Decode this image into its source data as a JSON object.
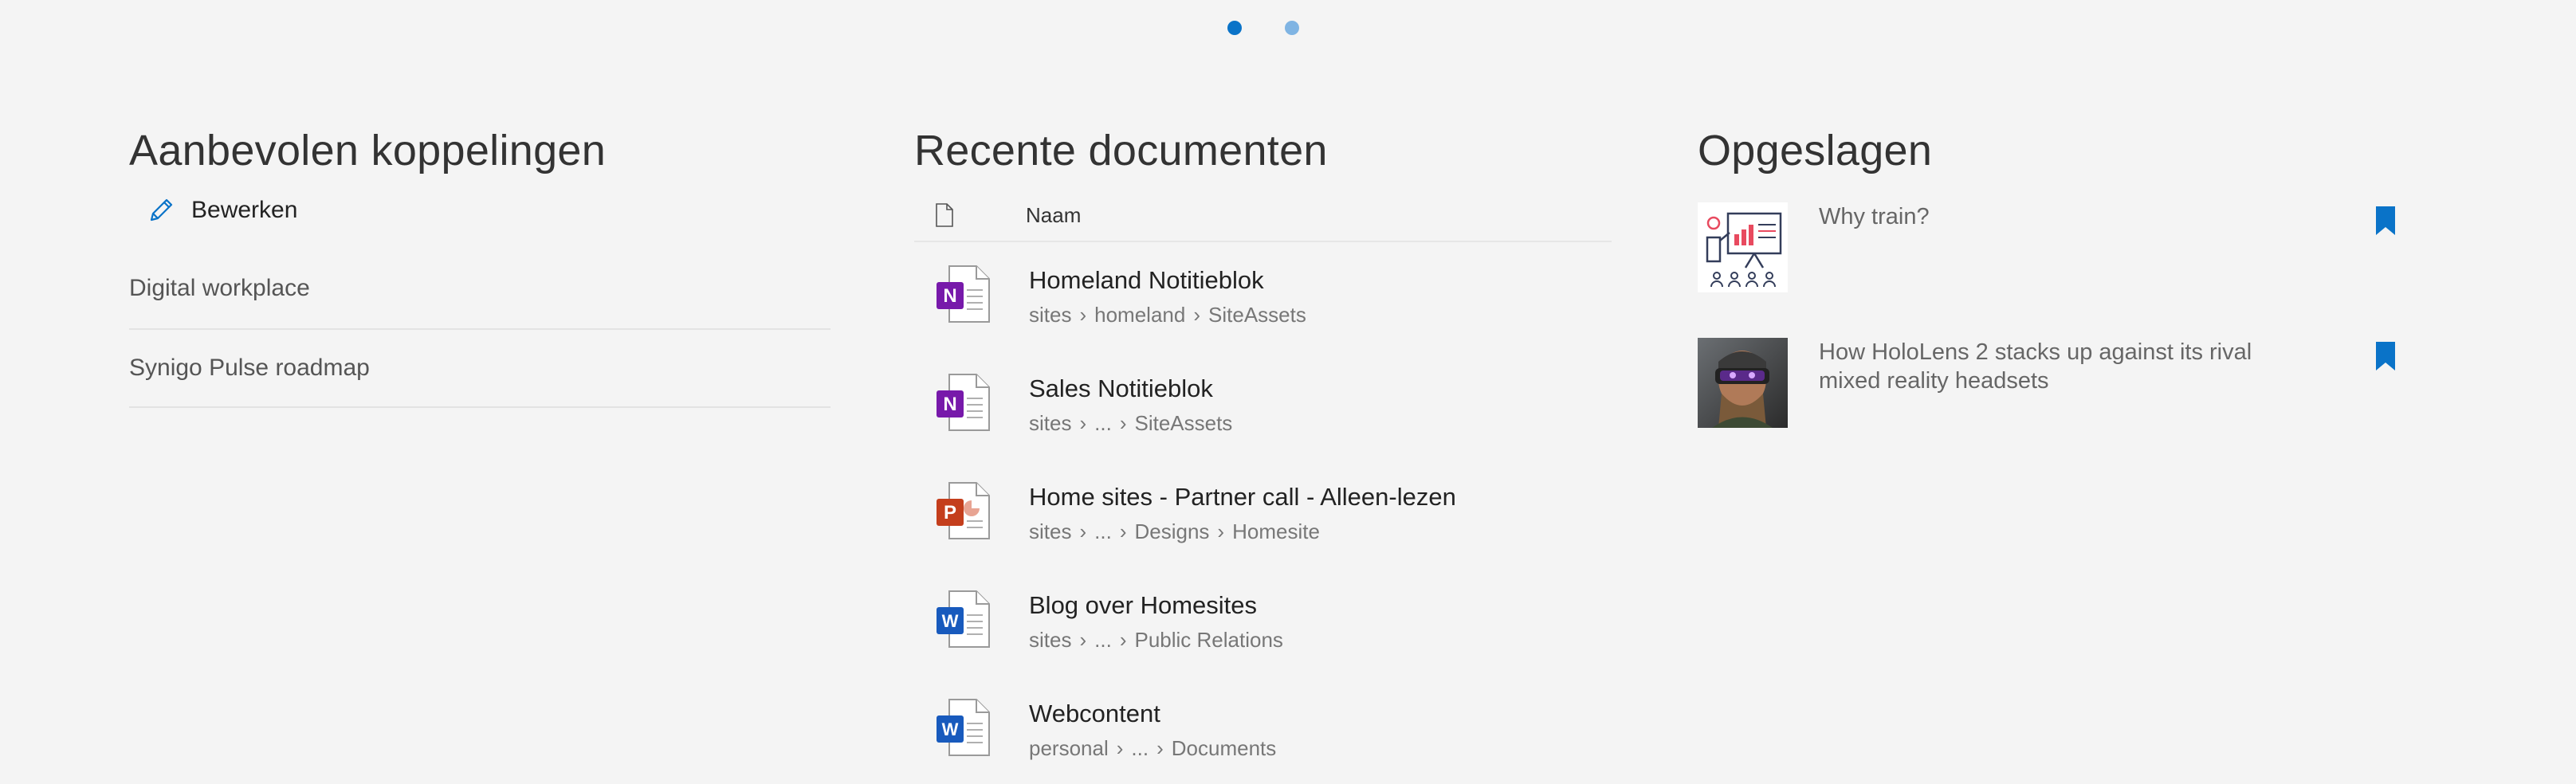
{
  "pager": {
    "dots": 2,
    "active_index": 0
  },
  "links": {
    "title": "Aanbevolen koppelingen",
    "edit_label": "Bewerken",
    "items": [
      {
        "label": "Digital workplace"
      },
      {
        "label": "Synigo Pulse roadmap"
      }
    ]
  },
  "recent": {
    "title": "Recente documenten",
    "column_name": "Naam",
    "items": [
      {
        "name": "Homeland Notitieblok",
        "type": "onenote",
        "path": [
          "sites",
          "homeland",
          "SiteAssets"
        ]
      },
      {
        "name": "Sales Notitieblok",
        "type": "onenote",
        "path": [
          "sites",
          "...",
          "SiteAssets"
        ]
      },
      {
        "name": "Home sites - Partner call - Alleen-lezen",
        "type": "powerpoint",
        "path": [
          "sites",
          "...",
          "Designs",
          "Homesite"
        ]
      },
      {
        "name": "Blog over Homesites",
        "type": "word",
        "path": [
          "sites",
          "...",
          "Public Relations"
        ]
      },
      {
        "name": "Webcontent",
        "type": "word",
        "path": [
          "personal",
          "...",
          "Documents"
        ]
      }
    ]
  },
  "saved": {
    "title": "Opgeslagen",
    "items": [
      {
        "title": "Why train?",
        "thumb": "training-presentation-illustration"
      },
      {
        "title": "How HoloLens 2 stacks up against its rival mixed reality headsets",
        "thumb": "person-wearing-headset-photo"
      }
    ]
  },
  "colors": {
    "background": "#f4f4f4",
    "accent": "#0a73c8",
    "onenote": "#7719aa",
    "powerpoint": "#c43e1c",
    "word": "#185abd"
  }
}
